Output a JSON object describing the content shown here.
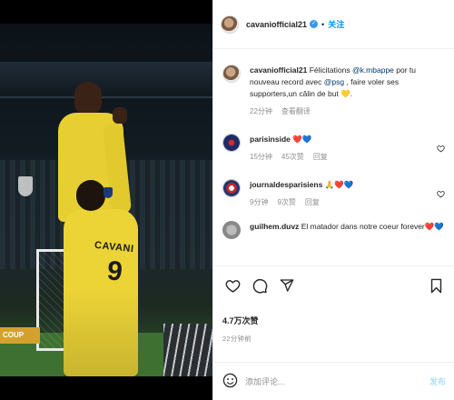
{
  "post": {
    "username": "cavaniofficial21",
    "verified_mark": "✓",
    "separator": "•",
    "follow_label": "关注"
  },
  "caption": {
    "username": "cavaniofficial21",
    "text_1": "Félicitations ",
    "mention_1": "@k.mbappe",
    "text_2": " por tu nouveau record avec ",
    "mention_2": "@psg",
    "text_3": " , faire voler ses supporters,un câlin de but ",
    "emoji": "💛",
    "text_4": ".",
    "time": "22分钟",
    "translate_label": "查看翻译"
  },
  "comments": [
    {
      "username": "parisinside",
      "text": "❤️💙",
      "time": "15分钟",
      "likes": "45次赞",
      "reply_label": "回复"
    },
    {
      "username": "journaldesparisiens",
      "text": "🙏❤️💙",
      "time": "9分钟",
      "likes": "9次赞",
      "reply_label": "回复"
    },
    {
      "username": "guilhem.duvz",
      "text": "El matador dans notre coeur forever❤️💙",
      "time": "",
      "likes": "",
      "reply_label": ""
    }
  ],
  "photo": {
    "jersey_name": "CAVANI",
    "jersey_number": "9",
    "adboard_text": "COUP"
  },
  "actions": {
    "likes_count": "4.7万次赞",
    "posted_time": "22分钟前"
  },
  "composer": {
    "placeholder": "添加评论...",
    "post_label": "发布"
  },
  "colors": {
    "accent": "#0095f6",
    "psg_yellow": "#e7cf33"
  },
  "icons": [
    "heart-icon",
    "comment-icon",
    "share-icon",
    "bookmark-icon",
    "emoji-icon",
    "verified-icon"
  ]
}
